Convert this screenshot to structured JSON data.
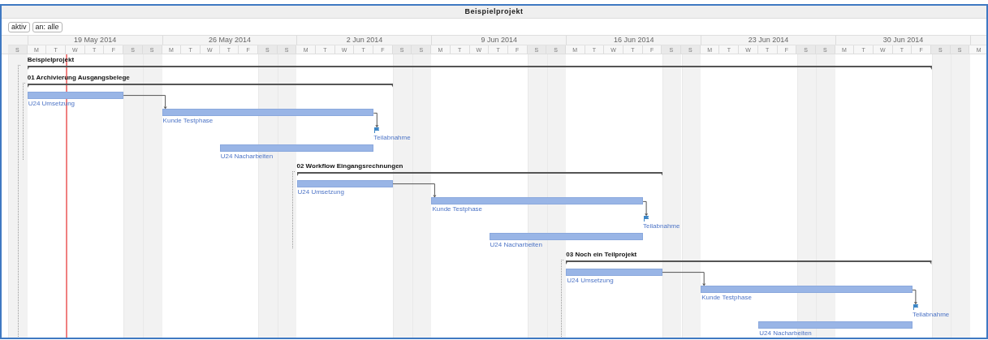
{
  "window": {
    "title": "Beispielprojekt"
  },
  "toolbar": {
    "buttons": [
      {
        "label": "aktiv"
      },
      {
        "label": "an: alle"
      }
    ]
  },
  "timeline": {
    "weeks": [
      {
        "label": "19 May 2014"
      },
      {
        "label": "26 May 2014"
      },
      {
        "label": "2 Jun 2014"
      },
      {
        "label": "9 Jun 2014"
      },
      {
        "label": "16 Jun 2014"
      },
      {
        "label": "23 Jun 2014"
      },
      {
        "label": "30 Jun 2014"
      }
    ],
    "days": [
      {
        "label": "S",
        "weekend": true
      },
      {
        "label": "M",
        "weekend": false
      },
      {
        "label": "T",
        "weekend": false
      },
      {
        "label": "W",
        "weekend": false
      },
      {
        "label": "T",
        "weekend": false
      },
      {
        "label": "F",
        "weekend": false
      },
      {
        "label": "S",
        "weekend": true
      },
      {
        "label": "S",
        "weekend": true
      },
      {
        "label": "M",
        "weekend": false
      },
      {
        "label": "T",
        "weekend": false
      },
      {
        "label": "W",
        "weekend": false
      },
      {
        "label": "T",
        "weekend": false
      },
      {
        "label": "F",
        "weekend": false
      },
      {
        "label": "S",
        "weekend": true
      },
      {
        "label": "S",
        "weekend": true
      },
      {
        "label": "M",
        "weekend": false
      },
      {
        "label": "T",
        "weekend": false
      },
      {
        "label": "W",
        "weekend": false
      },
      {
        "label": "T",
        "weekend": false
      },
      {
        "label": "F",
        "weekend": false
      },
      {
        "label": "S",
        "weekend": true
      },
      {
        "label": "S",
        "weekend": true
      },
      {
        "label": "M",
        "weekend": false
      },
      {
        "label": "T",
        "weekend": false
      },
      {
        "label": "W",
        "weekend": false
      },
      {
        "label": "T",
        "weekend": false
      },
      {
        "label": "F",
        "weekend": false
      },
      {
        "label": "S",
        "weekend": true
      },
      {
        "label": "S",
        "weekend": true
      },
      {
        "label": "M",
        "weekend": false
      },
      {
        "label": "T",
        "weekend": false
      },
      {
        "label": "W",
        "weekend": false
      },
      {
        "label": "T",
        "weekend": false
      },
      {
        "label": "F",
        "weekend": false
      },
      {
        "label": "S",
        "weekend": true
      },
      {
        "label": "S",
        "weekend": true
      },
      {
        "label": "M",
        "weekend": false
      },
      {
        "label": "T",
        "weekend": false
      },
      {
        "label": "W",
        "weekend": false
      },
      {
        "label": "T",
        "weekend": false
      },
      {
        "label": "F",
        "weekend": false
      },
      {
        "label": "S",
        "weekend": true
      },
      {
        "label": "S",
        "weekend": true
      },
      {
        "label": "M",
        "weekend": false
      },
      {
        "label": "T",
        "weekend": false
      },
      {
        "label": "W",
        "weekend": false
      },
      {
        "label": "T",
        "weekend": false
      },
      {
        "label": "F",
        "weekend": false
      },
      {
        "label": "S",
        "weekend": true
      },
      {
        "label": "S",
        "weekend": true
      },
      {
        "label": "M",
        "weekend": false
      }
    ]
  },
  "project": {
    "name": "Beispielprojekt",
    "children": [
      {
        "name": "01 Archivierung Ausgangsbelege",
        "children": [
          {
            "kind": "task",
            "name": "U24 Umsetzung",
            "linked": false
          },
          {
            "kind": "task",
            "name": "Kunde Testphase",
            "linked": true
          },
          {
            "kind": "milestone",
            "name": "Teilabnahme",
            "linked": true
          },
          {
            "kind": "task",
            "name": "U24 Nacharbeiten",
            "linked": false
          }
        ]
      },
      {
        "name": "02 Workflow Eingangsrechnungen",
        "children": [
          {
            "kind": "task",
            "name": "U24 Umsetzung",
            "linked": false
          },
          {
            "kind": "task",
            "name": "Kunde Testphase",
            "linked": true
          },
          {
            "kind": "milestone",
            "name": "Teilabnahme",
            "linked": true
          },
          {
            "kind": "task",
            "name": "U24 Nacharbeiten",
            "linked": false
          }
        ]
      },
      {
        "name": "03 Noch ein Teilprojekt",
        "children": [
          {
            "kind": "task",
            "name": "U24 Umsetzung",
            "linked": false
          },
          {
            "kind": "task",
            "name": "Kunde Testphase",
            "linked": true
          },
          {
            "kind": "milestone",
            "name": "Teilabnahme",
            "linked": true
          },
          {
            "kind": "task",
            "name": "U24 Nacharbeiten",
            "linked": false
          }
        ]
      }
    ]
  }
}
